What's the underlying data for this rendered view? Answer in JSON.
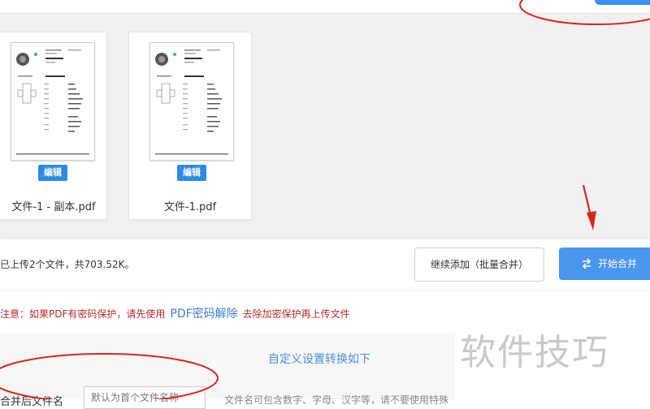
{
  "files": [
    {
      "name": "文件-1 - 副本.pdf",
      "edit_label": "编辑"
    },
    {
      "name": "文件-1.pdf",
      "edit_label": "编辑"
    }
  ],
  "actions": {
    "upload_info": "已上传2个文件，共703.52K。",
    "continue_label": "继续添加（批量合并）",
    "merge_label": "开始合并"
  },
  "notice": {
    "prefix": "注意：如果PDF有密码保护，请先使用",
    "link": "PDF密码解除",
    "suffix": "去除加密保护再上传文件"
  },
  "settings": {
    "title": "自定义设置转换如下",
    "filename_label": "合并后文件名",
    "filename_placeholder": "默认为首个文件名称",
    "hint": "文件名可包含数字、字母、汉字等，请不要使用特殊"
  },
  "watermark": "软件技巧",
  "colors": {
    "primary": "#4a95ee",
    "notice": "#b52a2a",
    "link": "#3a7fd4",
    "annotation": "#d9261c"
  },
  "icons": {
    "merge": "swap-arrows-icon"
  }
}
